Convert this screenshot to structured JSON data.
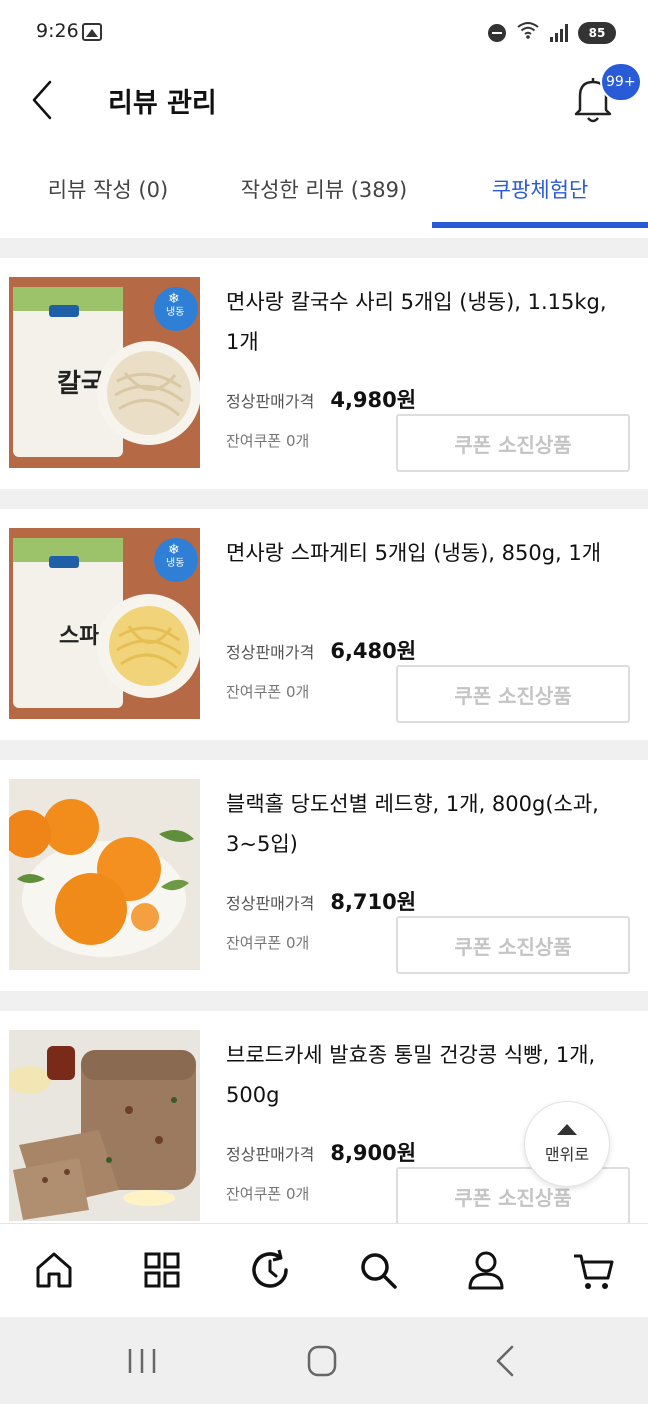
{
  "status_bar": {
    "time": "9:26",
    "battery": "85"
  },
  "header": {
    "title": "리뷰 관리",
    "badge": "99+"
  },
  "tabs": [
    {
      "label": "리뷰 작성 (0)"
    },
    {
      "label": "작성한 리뷰 (389)"
    },
    {
      "label": "쿠팡체험단"
    }
  ],
  "products": [
    {
      "name": "면사랑 칼국수 사리 5개입 (냉동), 1.15kg, 1개",
      "price_label": "정상판매가격",
      "price": "4,980원",
      "coupon_left": "잔여쿠폰 0개",
      "button": "쿠폰 소진상품",
      "image_text": "칼국수",
      "image_badge": "냉동"
    },
    {
      "name": "면사랑 스파게티 5개입 (냉동), 850g, 1개",
      "price_label": "정상판매가격",
      "price": "6,480원",
      "coupon_left": "잔여쿠폰 0개",
      "button": "쿠폰 소진상품",
      "image_text": "스파게티",
      "image_badge": "냉동"
    },
    {
      "name": "블랙홀 당도선별 레드향, 1개, 800g(소과, 3~5입)",
      "price_label": "정상판매가격",
      "price": "8,710원",
      "coupon_left": "잔여쿠폰 0개",
      "button": "쿠폰 소진상품"
    },
    {
      "name": "브로드카세 발효종 통밀 건강콩 식빵, 1개, 500g",
      "price_label": "정상판매가격",
      "price": "8,900원",
      "coupon_left": "잔여쿠폰 0개",
      "button": "쿠폰 소진상품"
    }
  ],
  "scroll_top": {
    "label": "맨위로"
  },
  "bottom_nav": [
    "home-icon",
    "category-icon",
    "recent-icon",
    "search-icon",
    "user-icon",
    "cart-icon"
  ],
  "colors": {
    "accent": "#2a5bd7"
  }
}
